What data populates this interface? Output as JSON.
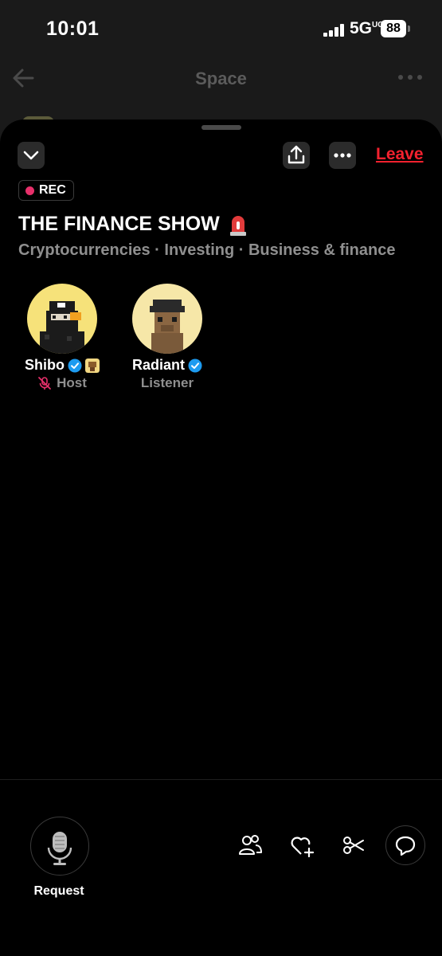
{
  "status_bar": {
    "time": "10:01",
    "network": "5G",
    "network_sup": "UC",
    "battery": "88"
  },
  "nav": {
    "title": "Space",
    "back_icon": "arrow-left-icon",
    "more_icon": "more-horizontal-icon"
  },
  "sheet": {
    "leave_label": "Leave",
    "rec_label": "REC",
    "title": "THE FINANCE SHOW",
    "title_emoji": "siren-icon",
    "topics": "Cryptocurrencies · Investing · Business & finance",
    "participants": [
      {
        "name": "Shibo",
        "role": "Host",
        "mic": "muted"
      },
      {
        "name": "Radiant",
        "role": "Listener"
      }
    ]
  },
  "bottom_bar": {
    "request_label": "Request"
  },
  "colors": {
    "accent_red": "#f4212e",
    "rec_dot": "#e8306b",
    "verified_blue": "#1d9bf0",
    "muted_text": "#8f8f8f"
  }
}
